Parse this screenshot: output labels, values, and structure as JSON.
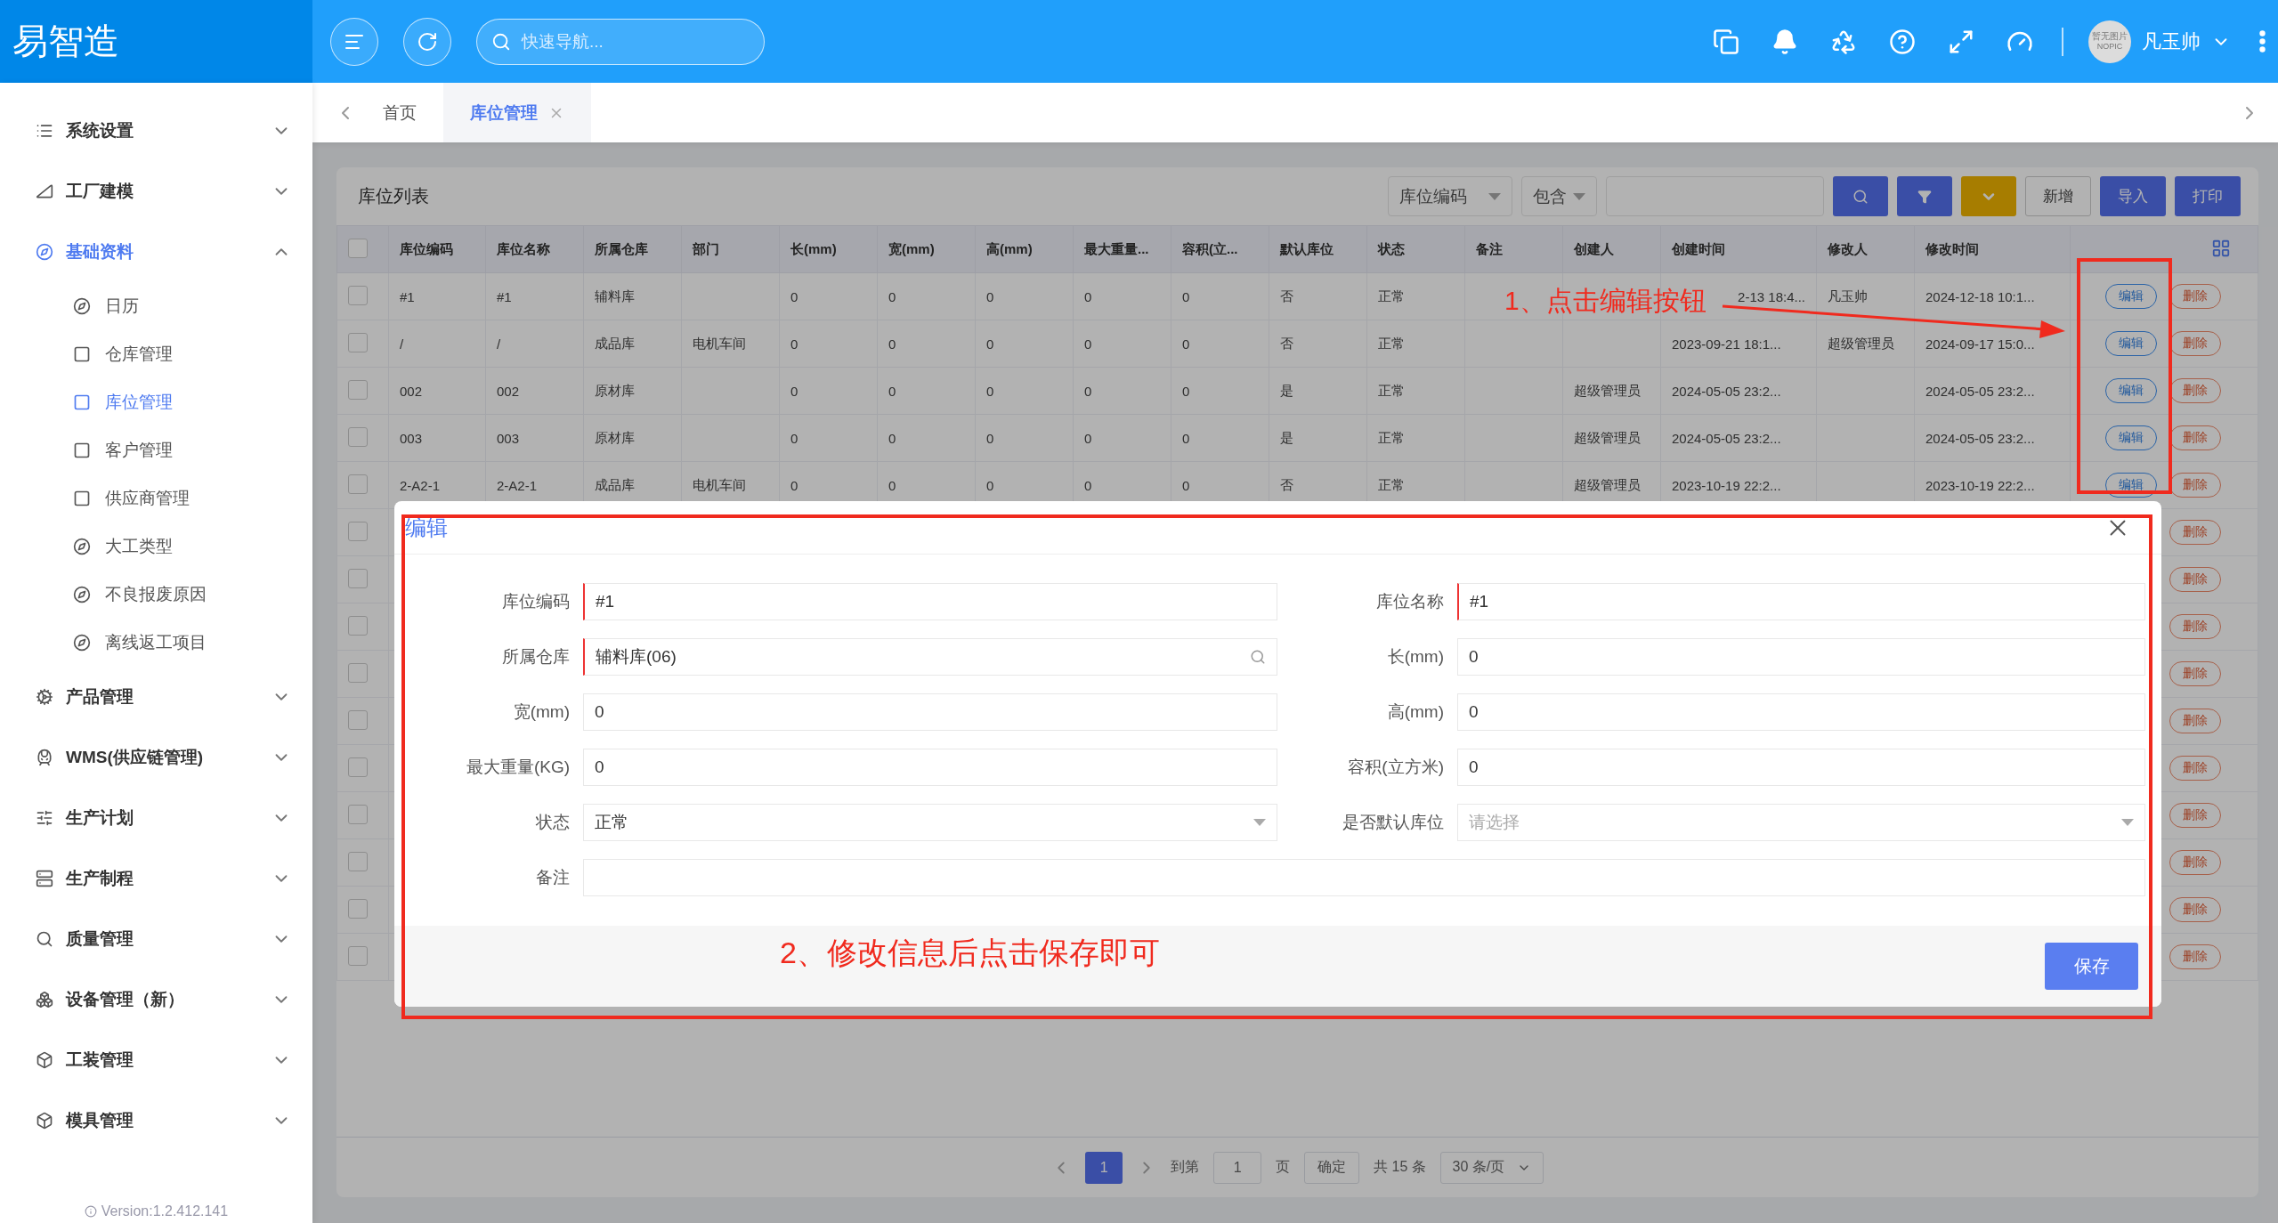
{
  "app": {
    "logo": "易智造"
  },
  "header": {
    "search": {
      "placeholder": "快速导航..."
    },
    "user": {
      "name": "凡玉帅",
      "avatar_lines": [
        "暂无图片",
        "NOPIC"
      ]
    }
  },
  "sidebar": {
    "items": [
      {
        "label": "系统设置",
        "kind": "list",
        "expanded": false,
        "selected": false
      },
      {
        "label": "工厂建模",
        "kind": "eject",
        "expanded": false,
        "selected": false
      },
      {
        "label": "基础资料",
        "kind": "compass",
        "expanded": true,
        "selected": true,
        "children": [
          {
            "label": "日历",
            "kind": "compass",
            "selected": false
          },
          {
            "label": "仓库管理",
            "kind": "square",
            "selected": false
          },
          {
            "label": "库位管理",
            "kind": "square",
            "selected": true
          },
          {
            "label": "客户管理",
            "kind": "square",
            "selected": false
          },
          {
            "label": "供应商管理",
            "kind": "square",
            "selected": false
          },
          {
            "label": "大工类型",
            "kind": "compass",
            "selected": false
          },
          {
            "label": "不良报废原因",
            "kind": "compass",
            "selected": false
          },
          {
            "label": "离线返工项目",
            "kind": "compass",
            "selected": false
          }
        ]
      },
      {
        "label": "产品管理",
        "kind": "cogs",
        "expanded": false,
        "selected": false
      },
      {
        "label": "WMS(供应链管理)",
        "kind": "train",
        "expanded": false,
        "selected": false
      },
      {
        "label": "生产计划",
        "kind": "sliders",
        "expanded": false,
        "selected": false
      },
      {
        "label": "生产制程",
        "kind": "server",
        "expanded": false,
        "selected": false
      },
      {
        "label": "质量管理",
        "kind": "q",
        "expanded": false,
        "selected": false
      },
      {
        "label": "设备管理（新）",
        "kind": "boxes",
        "expanded": false,
        "selected": false
      },
      {
        "label": "工装管理",
        "kind": "box",
        "expanded": false,
        "selected": false
      },
      {
        "label": "模具管理",
        "kind": "box",
        "expanded": false,
        "selected": false
      }
    ],
    "version": "Version:1.2.412.141"
  },
  "tabs": [
    {
      "label": "首页",
      "selected": false,
      "closable": false
    },
    {
      "label": "库位管理",
      "selected": true,
      "closable": true
    }
  ],
  "card": {
    "title": "库位列表",
    "filter_field": "库位编码",
    "filter_op": "包含",
    "buttons": [
      {
        "kind": "search"
      },
      {
        "kind": "filter"
      },
      {
        "kind": "more"
      },
      {
        "kind": "plain",
        "label": "新增"
      },
      {
        "kind": "primary",
        "label": "导入"
      },
      {
        "kind": "primary",
        "label": "打印"
      }
    ]
  },
  "table": {
    "header_checked": false,
    "columns": [
      "库位编码",
      "库位名称",
      "所属仓库",
      "部门",
      "长(mm)",
      "宽(mm)",
      "高(mm)",
      "最大重量...",
      "容积(立...",
      "默认库位",
      "状态",
      "备注",
      "创建人",
      "创建时间",
      "修改人",
      "修改时间"
    ],
    "rows": [
      {
        "checked": false,
        "annotated": true,
        "cells": [
          "#1",
          "#1",
          "辅料库",
          "",
          "0",
          "0",
          "0",
          "0",
          "0",
          "否",
          "正常",
          "",
          "",
          "2-13 18:4...",
          "凡玉帅",
          "2024-12-18 10:1..."
        ],
        "edit": "编辑",
        "delete": "删除"
      },
      {
        "checked": false,
        "annotated": false,
        "cells": [
          "/",
          "/",
          "成品库",
          "电机车间",
          "0",
          "0",
          "0",
          "0",
          "0",
          "否",
          "正常",
          "",
          "",
          "2023-09-21 18:1...",
          "超级管理员",
          "2024-09-17 15:0..."
        ],
        "edit": "编辑",
        "delete": "删除"
      },
      {
        "checked": false,
        "annotated": false,
        "cells": [
          "002",
          "002",
          "原材库",
          "",
          "0",
          "0",
          "0",
          "0",
          "0",
          "是",
          "正常",
          "",
          "超级管理员",
          "2024-05-05 23:2...",
          "",
          "2024-05-05 23:2..."
        ],
        "edit": "编辑",
        "delete": "删除"
      },
      {
        "checked": false,
        "annotated": false,
        "cells": [
          "003",
          "003",
          "原材库",
          "",
          "0",
          "0",
          "0",
          "0",
          "0",
          "是",
          "正常",
          "",
          "超级管理员",
          "2024-05-05 23:2...",
          "",
          "2024-05-05 23:2..."
        ],
        "edit": "编辑",
        "delete": "删除"
      },
      {
        "checked": false,
        "annotated": false,
        "cells": [
          "2-A2-1",
          "2-A2-1",
          "成品库",
          "电机车间",
          "0",
          "0",
          "0",
          "0",
          "0",
          "否",
          "正常",
          "",
          "超级管理员",
          "2023-10-19 22:2...",
          "",
          "2023-10-19 22:2..."
        ],
        "edit": "编辑",
        "delete": "删除"
      },
      {
        "checked": false,
        "delete": "删除"
      },
      {
        "checked": false,
        "delete": "删除"
      },
      {
        "checked": false,
        "delete": "删除"
      },
      {
        "checked": false,
        "delete": "删除"
      },
      {
        "checked": false,
        "delete": "删除"
      },
      {
        "checked": false,
        "delete": "删除"
      },
      {
        "checked": false,
        "delete": "删除"
      },
      {
        "checked": false,
        "delete": "删除"
      },
      {
        "checked": false,
        "delete": "删除"
      },
      {
        "checked": false,
        "delete": "删除"
      }
    ]
  },
  "pagination": {
    "current": "1",
    "goto_label": "到第",
    "goto_value": "1",
    "page_unit": "页",
    "confirm": "确定",
    "total": "共 15 条",
    "page_size": "30 条/页"
  },
  "dialog": {
    "title": "编辑",
    "save": "保存",
    "fields": [
      {
        "label": "库位编码",
        "kind": "input",
        "value": "#1",
        "required": true
      },
      {
        "label": "库位名称",
        "kind": "input",
        "value": "#1",
        "required": true
      },
      {
        "label": "所属仓库",
        "kind": "lookup",
        "value": "辅料库(06)",
        "required": true
      },
      {
        "label": "长(mm)",
        "kind": "input",
        "value": "0",
        "required": false
      },
      {
        "label": "宽(mm)",
        "kind": "input",
        "value": "0",
        "required": false
      },
      {
        "label": "高(mm)",
        "kind": "input",
        "value": "0",
        "required": false
      },
      {
        "label": "最大重量(KG)",
        "kind": "input",
        "value": "0",
        "required": false
      },
      {
        "label": "容积(立方米)",
        "kind": "input",
        "value": "0",
        "required": false
      },
      {
        "label": "状态",
        "kind": "select",
        "value": "正常",
        "required": false
      },
      {
        "label": "是否默认库位",
        "kind": "select",
        "placeholder": "请选择",
        "required": false
      },
      {
        "label": "备注",
        "kind": "textarea",
        "required": false
      }
    ]
  },
  "annotations": [
    "1、点击编辑按钮",
    "2、修改信息后点击保存即可"
  ]
}
